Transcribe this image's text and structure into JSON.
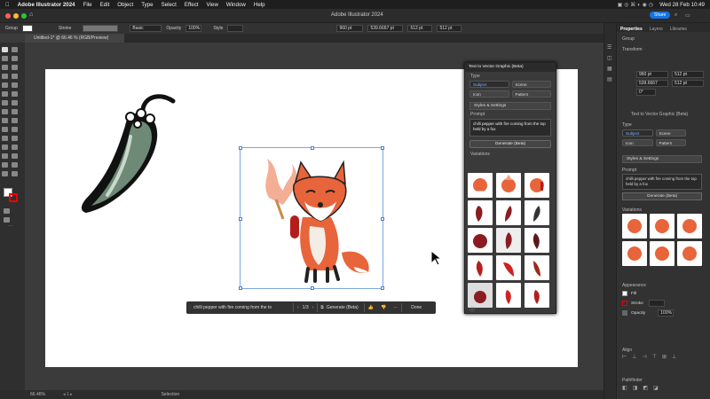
{
  "menubar": {
    "app": "Adobe Illustrator 2024",
    "items": [
      "File",
      "Edit",
      "Object",
      "Type",
      "Select",
      "Effect",
      "View",
      "Window",
      "Help"
    ],
    "clock": "Wed 28 Feb 10:49"
  },
  "titlebar": {
    "title": "Adobe Illustrator 2024",
    "share": "Share"
  },
  "control": {
    "group": "Group",
    "stroke": "Stroke",
    "basic": "Basic",
    "opacity": "Opacity",
    "opacity_val": "100%",
    "style": "Style",
    "x": "960 pt",
    "y": "539.6667 pt",
    "w": "512 pt",
    "h": "512 pt"
  },
  "document": {
    "tab": "Untitled-1* @ 66.46 % (RGB/Preview)"
  },
  "status": {
    "zoom": "66.46%",
    "tool": "Selection"
  },
  "ttv_panel": {
    "title": "Text to Vector Graphic (Beta)",
    "type_label": "Type",
    "types": [
      "Subject",
      "Scene",
      "Icon",
      "Pattern"
    ],
    "styles": "Styles & Settings",
    "prompt_label": "Prompt",
    "prompt": "chilli pepper with fire coming from the top held by a fox",
    "generate": "Generate (Beta)",
    "variations_label": "Variations"
  },
  "ctxbar": {
    "prompt": "chilli pepper with fire coming from the to",
    "page": "1/3",
    "generate": "Generate (Beta)",
    "done": "Done"
  },
  "properties": {
    "tabs": [
      "Properties",
      "Layers",
      "Libraries"
    ],
    "group": "Group",
    "transform": "Transform",
    "x": "960 pt",
    "y": "539.6667",
    "w": "512 pt",
    "h": "512 pt",
    "rot": "0°",
    "ttv_header": "Text to Vector Graphic (Beta)",
    "type_label": "Type",
    "types": [
      "Subject",
      "Scene",
      "Icon",
      "Pattern"
    ],
    "styles": "Styles & Settings",
    "prompt_label": "Prompt",
    "prompt": "chilli pepper with fire coming from the top held by a fox",
    "generate": "Generate (Beta)",
    "variations": "Variations",
    "appearance": "Appearance",
    "fill": "Fill",
    "stroke": "Stroke",
    "opacity": "Opacity",
    "opacity_val": "100%",
    "align": "Align",
    "pathfinder": "Pathfinder"
  },
  "colors": {
    "accent": "#2a7fff",
    "canvas": "#ffffff",
    "pepper": "#6e8a76",
    "fox": "#e8643a"
  }
}
